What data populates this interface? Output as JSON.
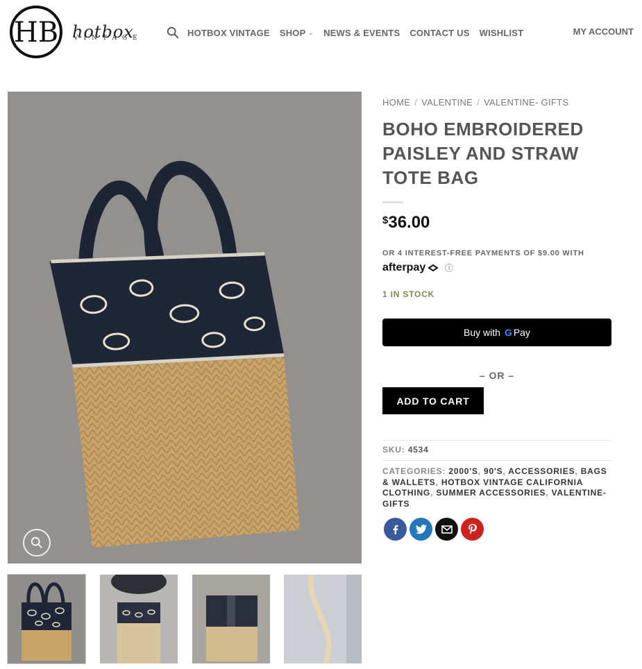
{
  "header": {
    "logo": {
      "word": "hotbox",
      "sub": "VINTAGE",
      "monogram": "HB"
    },
    "nav": [
      {
        "label": "HOTBOX VINTAGE",
        "has_dropdown": false
      },
      {
        "label": "SHOP",
        "has_dropdown": true
      },
      {
        "label": "NEWS & EVENTS",
        "has_dropdown": false
      },
      {
        "label": "CONTACT US",
        "has_dropdown": false
      },
      {
        "label": "WISHLIST",
        "has_dropdown": false
      }
    ],
    "account": "MY ACCOUNT",
    "icons": {
      "search": "search-icon",
      "dropdown": "chevron-down-icon"
    }
  },
  "breadcrumb": [
    "HOME",
    "VALENTINE",
    "VALENTINE- GIFTS"
  ],
  "product": {
    "title": "BOHO EMBROIDERED PAISLEY AND STRAW TOTE BAG",
    "currency": "$",
    "price": "36.00",
    "afterpay_text": "OR 4 INTEREST-FREE PAYMENTS OF $9.00 WITH",
    "afterpay_brand": "afterpay",
    "stock": "1 IN STOCK",
    "gpay_prefix": "Buy with",
    "gpay_brand": "Pay",
    "or_text": "– OR –",
    "add_to_cart": "ADD TO CART",
    "sku_label": "SKU:",
    "sku": "4534",
    "categories_label": "CATEGORIES:",
    "categories": [
      "2000'S",
      "90'S",
      "ACCESSORIES",
      "BAGS & WALLETS",
      "HOTBOX VINTAGE CALIFORNIA CLOTHING",
      "SUMMER ACCESSORIES",
      "VALENTINE- GIFTS"
    ]
  },
  "share": [
    {
      "name": "facebook",
      "color": "#3a589d"
    },
    {
      "name": "twitter",
      "color": "#2478ba"
    },
    {
      "name": "email",
      "color": "#111111"
    },
    {
      "name": "pinterest",
      "color": "#cb2320"
    }
  ],
  "colors": {
    "stock": "#7a8a52",
    "button": "#000000",
    "text": "#555555"
  }
}
